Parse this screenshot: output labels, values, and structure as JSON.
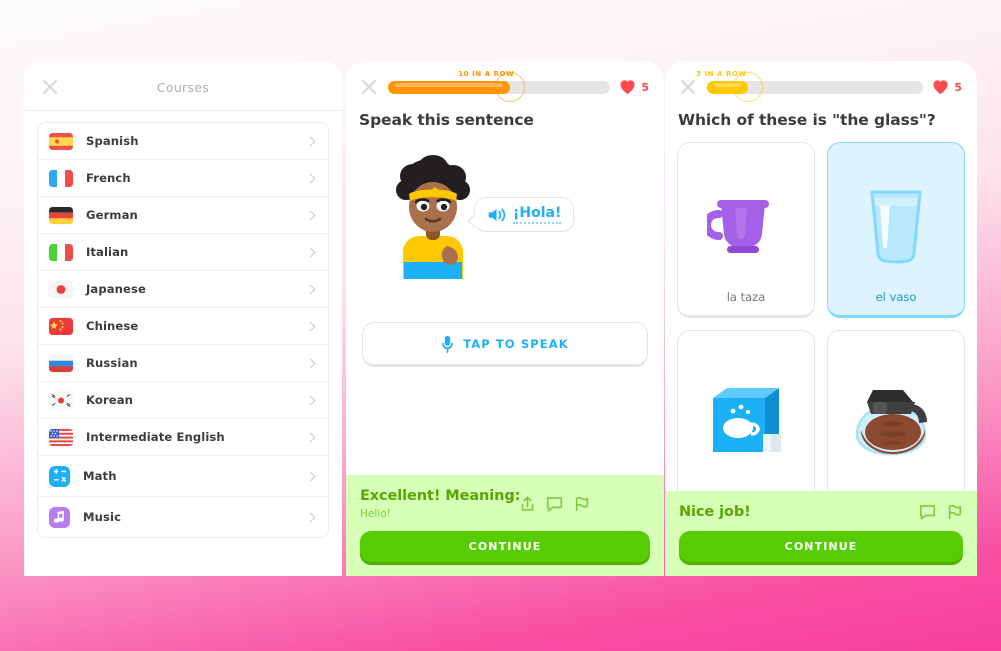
{
  "background": {
    "top_color": "#fdfbfb",
    "bottom_color": "#f73f9b"
  },
  "courses_screen": {
    "frame_color": "#FF9600",
    "close_icon": "close-icon",
    "title": "Courses",
    "items": [
      {
        "label": "Spanish",
        "icon": "flag-spain"
      },
      {
        "label": "French",
        "icon": "flag-france"
      },
      {
        "label": "German",
        "icon": "flag-germany"
      },
      {
        "label": "Italian",
        "icon": "flag-italy"
      },
      {
        "label": "Japanese",
        "icon": "flag-japan"
      },
      {
        "label": "Chinese",
        "icon": "flag-china"
      },
      {
        "label": "Russian",
        "icon": "flag-russia"
      },
      {
        "label": "Korean",
        "icon": "flag-south-korea"
      },
      {
        "label": "Intermediate English",
        "icon": "flag-usa"
      },
      {
        "label": "Math",
        "icon": "math-icon"
      },
      {
        "label": "Music",
        "icon": "music-note-icon"
      }
    ]
  },
  "speak_screen": {
    "frame_color": "#FFC800",
    "close_icon": "close-icon",
    "streak_label": "10 IN A ROW",
    "streak_color": "#FF9600",
    "progress_percent": 55,
    "progress_color": "#FF9600",
    "hearts_count": "5",
    "heart_color": "#ff4b4b",
    "question": "Speak this sentence",
    "character": "bea-character",
    "bubble": {
      "speaker_icon": "speaker-icon",
      "text": "¡Hola!"
    },
    "tap_button": {
      "icon": "microphone-icon",
      "label": "TAP TO SPEAK"
    },
    "feedback": {
      "title": "Excellent! Meaning:",
      "subtitle": "Hello!",
      "icons": [
        "share-icon",
        "comment-icon",
        "report-flag-icon"
      ],
      "cta": "CONTINUE",
      "bg_color": "#D7FFB8",
      "text_color": "#58A700",
      "cta_color": "#58CC02"
    }
  },
  "choice_screen": {
    "frame_color": "#1CB0F6",
    "close_icon": "close-icon",
    "streak_label": "3 IN A ROW",
    "streak_color": "#FFC800",
    "progress_percent": 19,
    "progress_color": "#FFC800",
    "hearts_count": "5",
    "question": "Which of these is \"the glass\"?",
    "options": [
      {
        "label": "la taza",
        "icon": "purple-mug-image",
        "selected": false
      },
      {
        "label": "el vaso",
        "icon": "glass-of-water-image",
        "selected": true
      },
      {
        "label": "",
        "icon": "coffee-box-image",
        "selected": false
      },
      {
        "label": "",
        "icon": "coffee-pot-image",
        "selected": false
      }
    ],
    "feedback": {
      "title": "Nice job!",
      "icons": [
        "comment-icon",
        "report-flag-icon"
      ],
      "cta": "CONTINUE"
    }
  }
}
